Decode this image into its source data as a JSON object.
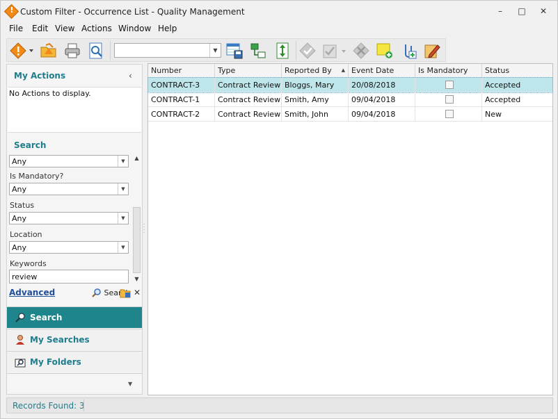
{
  "window": {
    "title": "Custom Filter - Occurrence List - Quality Management",
    "min_glyph": "–",
    "max_glyph": "□",
    "close_glyph": "✕"
  },
  "menu": {
    "items": [
      "File",
      "Edit",
      "View",
      "Actions",
      "Window",
      "Help"
    ]
  },
  "toolbar": {
    "combo_value": "",
    "icons": [
      "new-occurrence-icon",
      "open-folder-icon",
      "print-icon",
      "preview-icon",
      "save-layout-icon",
      "workflow-icon",
      "expand-rows-icon",
      "approve-icon",
      "sign-off-icon",
      "delete-icon",
      "add-note-icon",
      "attach-icon",
      "edit-icon"
    ]
  },
  "left_panel": {
    "my_actions_title": "My Actions",
    "collapse_glyph": "‹",
    "no_actions_text": "No Actions to display.",
    "search_title": "Search",
    "fields": [
      {
        "label": "",
        "value": "Any"
      },
      {
        "label": "Is Mandatory?",
        "value": "Any"
      },
      {
        "label": "Status",
        "value": "Any"
      },
      {
        "label": "Location",
        "value": "Any"
      }
    ],
    "keywords_label": "Keywords",
    "keywords_value": "review",
    "advanced_label": "Advanced",
    "search_label": "Search",
    "clear_glyph": "✕",
    "nav": [
      {
        "label": "Search",
        "icon": "search-people-icon",
        "active": true
      },
      {
        "label": "My Searches",
        "icon": "user-search-icon",
        "active": false
      },
      {
        "label": "My Folders",
        "icon": "folder-search-icon",
        "active": false
      }
    ],
    "more_glyph": "▼"
  },
  "grid": {
    "columns": [
      "Number",
      "Type",
      "Reported By",
      "Event Date",
      "Is Mandatory",
      "Status"
    ],
    "sorted_column": "Reported By",
    "sort_direction": "ascending",
    "rows": [
      {
        "number": "CONTRACT-3",
        "type": "Contract Review",
        "reported_by": "Bloggs, Mary",
        "event_date": "20/08/2018",
        "is_mandatory": false,
        "status": "Accepted",
        "selected": true
      },
      {
        "number": "CONTRACT-1",
        "type": "Contract Review",
        "reported_by": "Smith, Amy",
        "event_date": "09/04/2018",
        "is_mandatory": false,
        "status": "Accepted",
        "selected": false
      },
      {
        "number": "CONTRACT-2",
        "type": "Contract Review",
        "reported_by": "Smith, John",
        "event_date": "09/04/2018",
        "is_mandatory": false,
        "status": "New",
        "selected": false
      }
    ]
  },
  "status_bar": {
    "records_found": "Records Found: 3"
  },
  "colors": {
    "accent": "#1e858c",
    "selected_row": "#bfe6ea",
    "link": "#1f4f9a"
  }
}
